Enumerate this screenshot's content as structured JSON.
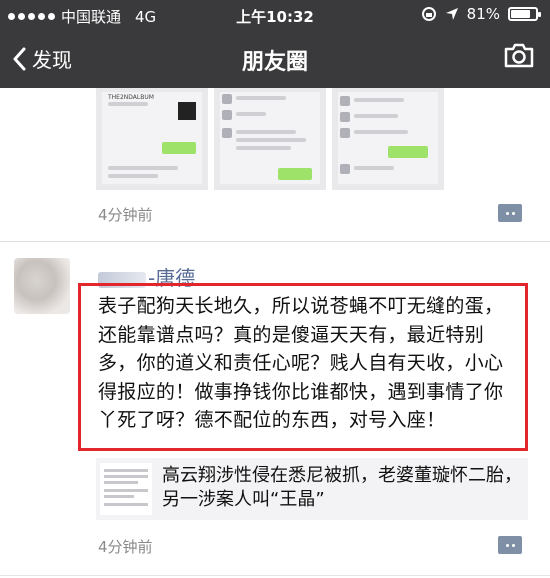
{
  "status_bar": {
    "carrier": "中国联通",
    "network": "4G",
    "time": "上午10:32",
    "battery": "81%",
    "battery_level": 0.81
  },
  "nav": {
    "back_label": "发现",
    "title": "朋友圈"
  },
  "post_1": {
    "time": "4分钟前",
    "thumb_1_header": "THE2NDALBUM"
  },
  "post_2": {
    "username": "-唐德",
    "text": "表子配狗天长地久，所以说苍蝇不叮无缝的蛋，还能靠谱点吗？真的是傻逼天天有，最近特别多，你的道义和责任心呢？贱人自有天收，小心得报应的！做事挣钱你比谁都快，遇到事情了你丫死了呀？德不配位的东西，对号入座！",
    "link_title": "高云翔涉性侵在悉尼被抓，老婆董璇怀二胎，另一涉案人叫“王晶”",
    "time": "4分钟前"
  },
  "colors": {
    "nav_bg": "#3a3a3c",
    "link_blue": "#576b95",
    "highlight_red": "#e3262b"
  }
}
